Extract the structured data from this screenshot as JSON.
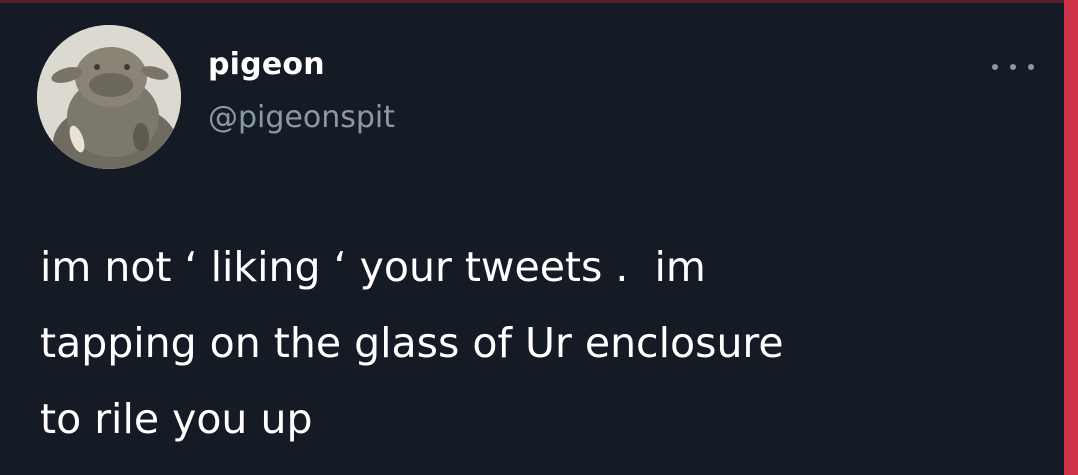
{
  "tweet": {
    "display_name": "pigeon",
    "handle": "@pigeonspit",
    "text_lines": [
      "im not ‘ liking ‘ your tweets .  im",
      "tapping on the glass of Ur enclosure",
      "to rile you up"
    ],
    "more_icon": "more-horizontal-icon"
  },
  "colors": {
    "background": "#151b25",
    "text_primary": "#ffffff",
    "text_secondary": "#8b98a5",
    "accent_strip": "#d0344a"
  }
}
